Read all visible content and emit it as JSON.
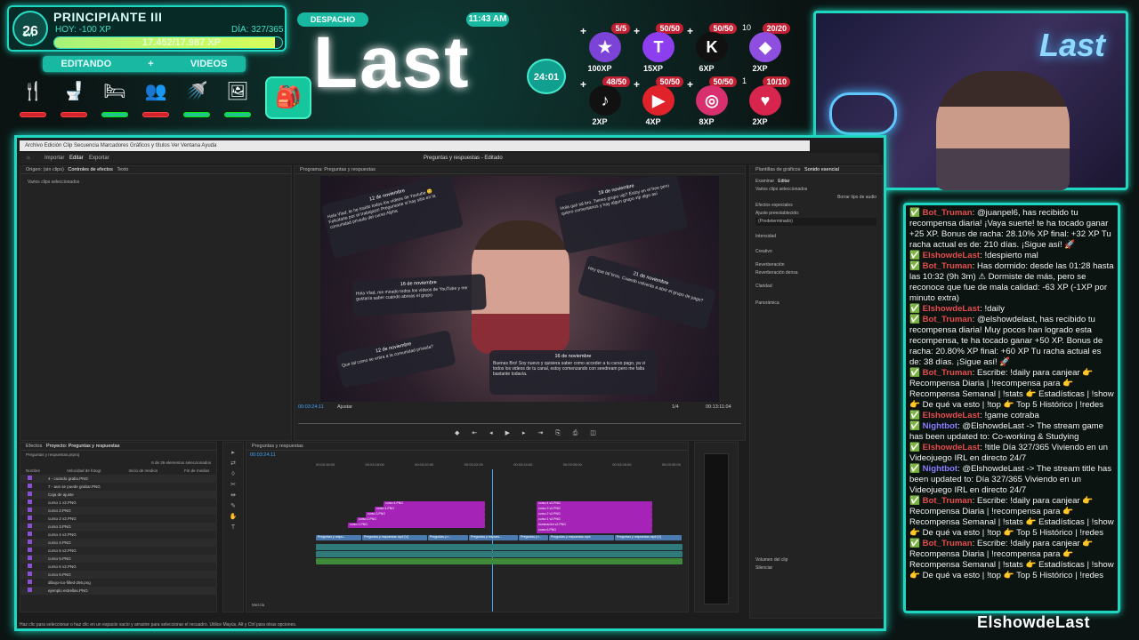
{
  "hud": {
    "level_small": "Lvl",
    "level": "26",
    "rank": "PRINCIPIANTE III",
    "xp_today": "HOY: -100 XP",
    "day": "DÍA: 327/365",
    "xp_progress": "17.452/17.987 XP",
    "xp_fraction": 0.97,
    "mode_left": "EDITANDO",
    "mode_plus": "+",
    "mode_right": "VIDEOS",
    "needs": [
      {
        "icon": "fork-knife-icon",
        "glyph": "🍴",
        "low": true
      },
      {
        "icon": "toilet-icon",
        "glyph": "🚽",
        "low": true
      },
      {
        "icon": "bed-icon",
        "glyph": "🛏",
        "low": false
      },
      {
        "icon": "social-icon",
        "glyph": "👥",
        "low": true
      },
      {
        "icon": "shower-icon",
        "glyph": "🚿",
        "low": false
      },
      {
        "icon": "fun-icon",
        "glyph": "🖼",
        "low": false
      }
    ],
    "backpack_glyph": "🎒"
  },
  "header": {
    "location": "DESPACHO",
    "clock": "11:43 AM",
    "logo": "Last",
    "timer": "24:01"
  },
  "goals": [
    {
      "name": "star-goal",
      "plus": "+",
      "rank": "1",
      "count": "5/5",
      "glyph": "★",
      "xp": "100XP",
      "color": "#7b43d6"
    },
    {
      "name": "twitch-goal",
      "plus": "+",
      "rank": "",
      "count": "50/50",
      "glyph": "T",
      "xp": "15XP",
      "color": "#8d3ff0"
    },
    {
      "name": "kick-goal",
      "plus": "+",
      "rank": "",
      "count": "50/50",
      "glyph": "K",
      "xp": "6XP",
      "color": "#111"
    },
    {
      "name": "crystal-goal",
      "plus": "",
      "rank": "10",
      "count": "20/20",
      "glyph": "◆",
      "xp": "2XP",
      "color": "#8e4fe0"
    },
    {
      "name": "tiktok-goal",
      "plus": "+",
      "rank": "",
      "count": "48/50",
      "glyph": "♪",
      "xp": "2XP",
      "color": "#111"
    },
    {
      "name": "youtube-goal",
      "plus": "+",
      "rank": "",
      "count": "50/50",
      "glyph": "▶",
      "xp": "4XP",
      "color": "#e0222a"
    },
    {
      "name": "instagram-goal",
      "plus": "+",
      "rank": "",
      "count": "50/50",
      "glyph": "◎",
      "xp": "8XP",
      "color": "#d8306f"
    },
    {
      "name": "gift-goal",
      "plus": "",
      "rank": "1",
      "count": "10/10",
      "glyph": "♥",
      "xp": "2XP",
      "color": "#d8254e"
    }
  ],
  "webcam": {
    "neon_text": "Last"
  },
  "chat": [
    {
      "user": "Bot_Truman",
      "color": "#e74c4c",
      "text": ": @juanpel6, has recibido tu recompensa diaria! ¡Vaya suerte! te ha tocado ganar +25 XP. Bonus de racha: 28.10% XP final: +32 XP Tu racha actual es de: 210 días. ¡Sigue así! 🚀"
    },
    {
      "user": "ElshowdeLast",
      "color": "#e74c4c",
      "text": ": !despierto mal"
    },
    {
      "user": "Bot_Truman",
      "color": "#e74c4c",
      "text": ": Has dormido: desde las 01:28 hasta las 10:32 (9h 3m) ⚠ Dormiste de más, pero se reconoce que fue de mala calidad: -63 XP (-1XP por minuto extra)"
    },
    {
      "user": "ElshowdeLast",
      "color": "#e74c4c",
      "text": ": !daily"
    },
    {
      "user": "Bot_Truman",
      "color": "#e74c4c",
      "text": ": @elshowdelast, has recibido tu recompensa diaria! Muy pocos han logrado esta recompensa, te ha tocado ganar +50 XP. Bonus de racha: 20.80% XP final: +60 XP Tu racha actual es de: 38 días. ¡Sigue así! 🚀"
    },
    {
      "user": "Bot_Truman",
      "color": "#e74c4c",
      "text": ": Escribe: !daily para canjear 👉 Recompensa Diaria | !recompensa para 👉 Recompensa Semanal | !stats 👉 Estadísticas | !show 👉 De qué va esto | !top 👉 Top 5 Histórico | !redes"
    },
    {
      "user": "ElshowdeLast",
      "color": "#e74c4c",
      "text": ": !game cotraba"
    },
    {
      "user": "Nightbot",
      "color": "#8a7cff",
      "text": ": @ElshowdeLast -> The stream game has been updated to: Co-working & Studying"
    },
    {
      "user": "ElshowdeLast",
      "color": "#e74c4c",
      "text": ": !title Día 327/365 Viviendo en un Videojuego IRL en directo 24/7"
    },
    {
      "user": "Nightbot",
      "color": "#8a7cff",
      "text": ": @ElshowdeLast -> The stream title has been updated to: Día 327/365 Viviendo en un Videojuego IRL en directo 24/7"
    },
    {
      "user": "Bot_Truman",
      "color": "#e74c4c",
      "text": ": Escribe: !daily para canjear 👉 Recompensa Diaria | !recompensa para 👉 Recompensa Semanal | !stats 👉 Estadísticas | !show 👉 De qué va esto | !top 👉 Top 5 Histórico | !redes"
    },
    {
      "user": "Bot_Truman",
      "color": "#e74c4c",
      "text": ": Escribe: !daily para canjear 👉 Recompensa Diaria | !recompensa para 👉 Recompensa Semanal | !stats 👉 Estadísticas | !show 👉 De qué va esto | !top 👉 Top 5 Histórico | !redes"
    }
  ],
  "brand": "ElshowdeLast",
  "editor": {
    "menu": "Archivo  Edición  Clip  Secuencia  Marcadores  Gráficos y títulos  Ver  Ventana  Ayuda",
    "tab_import": "Importar",
    "tab_edit": "Editar",
    "tab_export": "Exportar",
    "title": "Preguntas y respuestas - Editado",
    "source_tab": "Origen: (sin clips)",
    "effect_controls_tab": "Controles de efectos",
    "text_tab": "Texto",
    "source_msg": "Varios clips seleccionados",
    "program_tab": "Programa: Preguntas y respuestas",
    "timecode": "00:03:24:11",
    "fit": "Ajustar",
    "quality": "1/4",
    "duration": "00:13:11:04",
    "graphics_tab": "Plantillas de gráficos",
    "essential_sound_tab": "Sonido esencial",
    "browse": "Examinar",
    "edit": "Editar",
    "clips_selected": "Varios clips seleccionados",
    "clear_audio": "Borrar tipo de audio",
    "special_fx": "Efectos especiales",
    "preset_label": "Ajuste preestablecido:",
    "preset_value": "(Predeterminado)",
    "intensity": "Intensidad",
    "creative": "Creativo",
    "reverb": "Reverberación",
    "reverb_preset": "Reverberación densa",
    "clarity": "Claridad",
    "panorama": "Panorámica",
    "clip_volume": "Volumen del clip",
    "mute": "Silenciar",
    "project_tab": "Proyecto: Preguntas y respuestas",
    "effects_tab": "Efectos",
    "project_file": "Preguntas y respuestas.prproj",
    "item_count": "6 de 36 elementos seleccionados",
    "col_name": "Nombre",
    "col_fps": "Velocidad de fotogr.",
    "col_start": "Inicio de medios",
    "col_end": "Fin de medios",
    "col_dur": "Du",
    "files": [
      "4 - cuando grabo.PNG",
      "7 - aun se puede grabar.PNG",
      "Caja de ajuste",
      "curso 1 v2.PNG",
      "curso 2.PNG",
      "curso 2 v2.PNG",
      "curso 3.PNG",
      "curso 4 v2.PNG",
      "curso 4.PNG",
      "curso 5 v2.PNG",
      "curso 5.PNG",
      "curso 6 v2.PNG",
      "curso 6.PNG",
      "dibujo-ico-filled-256.png",
      "ejemplo estrellas.PNG"
    ],
    "timeline_tab": "Preguntas y respuestas",
    "timeline_tc": "00:03:24:11",
    "ruler": [
      "00:03:16:00",
      "00:03:18:00",
      "00:03:20:00",
      "00:03:22:00",
      "00:03:24:00",
      "00:03:26:00",
      "00:03:28:00",
      "00:03:30:00"
    ],
    "clips_a": [
      "curso 4.PNG",
      "curso 4.PNG",
      "curso 3.PNG",
      "curso 2.PNG",
      "curso 1.PNG"
    ],
    "clips_b": [
      "curso 4 v2.PNG",
      "curso 3 v2.PNG",
      "curso 2 v2.PNG",
      "curso 1 v2.PNG",
      "Iluminación v2.PNG",
      "curso 6.PNG"
    ],
    "video_clips": [
      "Preguntas y respu...",
      "Preguntas y respuestas.mp4 [V]",
      "Preguntas y r...",
      "Preguntas y respues...",
      "Preguntas y r...",
      "Preguntas y respuestas.mp4",
      "Preguntas y respuestas.mp4 [V]"
    ],
    "mix": "Mezcla",
    "status": "Haz clic para seleccionar o haz clic en un espacio vacío y arrastre para seleccionar el recuadro. Utilice Mayús, Alt y Ctrl para otras opciones."
  },
  "video": {
    "bubbles": [
      {
        "date": "12 de noviembre",
        "text": "Hola Vlad, te he traído todos los vídeos de Youtube 😊 Felicitarte por el trabajazo! Preguntarte si hay sitio en la comunidad privada del curso Alpha"
      },
      {
        "date": "19 de noviembre",
        "text": "Hola qué tal bro. Tienes grupo vip? Estoy en el free pero quiero comentarios y hay algun grupo vip algo así"
      },
      {
        "date": "16 de noviembre",
        "text": "Hola Vlad, me mirado todos los vídeos de YouTube y me gustaría saber cuándo abrirás el grupo"
      },
      {
        "date": "21 de noviembre",
        "text": "Hey que tal brou. Cuando volverás a abrir el grupo de pago?"
      },
      {
        "date": "12 de noviembre",
        "text": "Que tal como se entra a la comunidad privada?"
      },
      {
        "date": "16 de noviembre",
        "text": "Buenas Bro! Soy nuevo y quisiera saber como acceder a tu curso pago, ya vi todos los videos de tu canal, estoy comenzando con seedream pero me falta bastante todavía."
      }
    ]
  }
}
